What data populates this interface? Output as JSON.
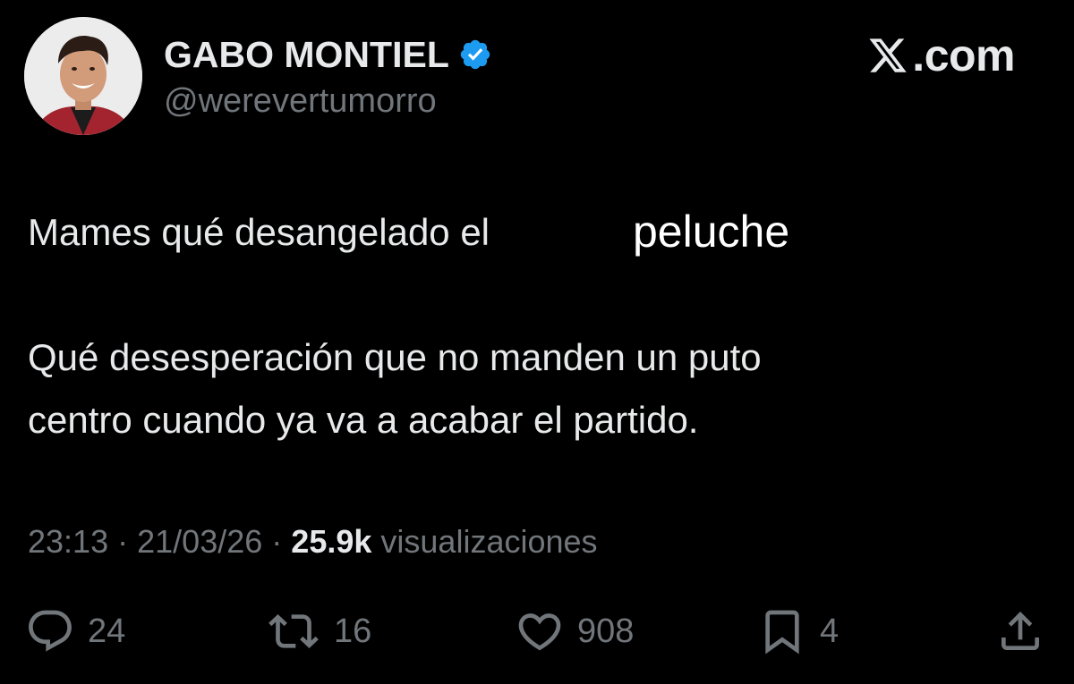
{
  "header": {
    "display_name": "GABO MONTIEL",
    "handle": "@werevertumorro",
    "brand": ".com",
    "verified_color": "#1d9bf0"
  },
  "tweet": {
    "line1": "Mames qué desangelado el",
    "line1_extra": "peluche",
    "line2": "Qué desesperación que no manden un puto",
    "line3": "centro cuando ya va a acabar el partido."
  },
  "meta": {
    "time": "23:13",
    "separator": "·",
    "date": "21/03/26",
    "views_count": "25.9k",
    "views_label": "visualizaciones"
  },
  "actions": {
    "replies": "24",
    "reposts": "16",
    "likes": "908",
    "bookmarks": "4"
  },
  "icons": {
    "reply": "speech-bubble-icon",
    "repost": "repost-arrows-icon",
    "like": "heart-icon",
    "bookmark": "bookmark-icon",
    "share": "share-upload-icon",
    "brand": "x-logo-icon",
    "verified": "verified-badge-icon"
  },
  "colors": {
    "background": "#000000",
    "text_primary": "#e7e9ea",
    "text_secondary": "#71767b"
  }
}
